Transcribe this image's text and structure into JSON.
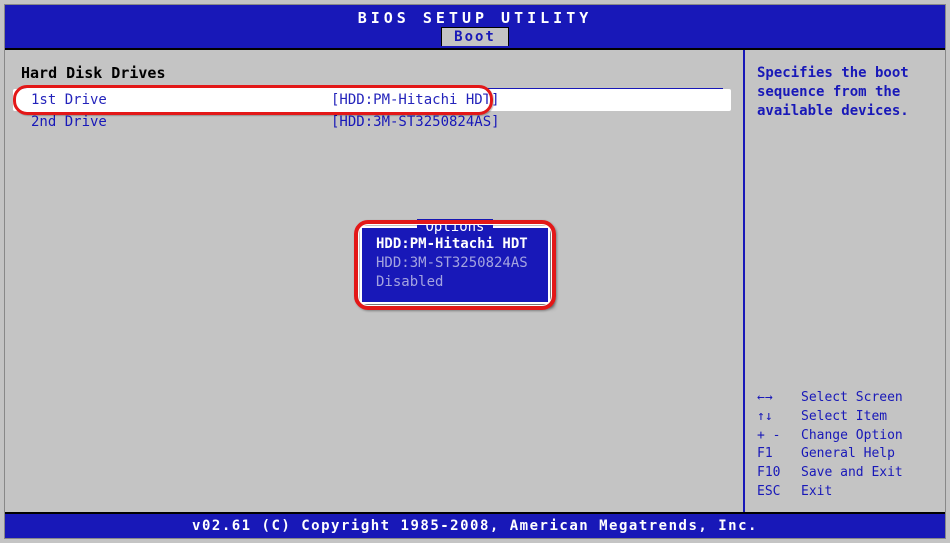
{
  "title": "BIOS SETUP UTILITY",
  "tab": "Boot",
  "section_title": "Hard Disk Drives",
  "drives": [
    {
      "label": "1st Drive",
      "value": "[HDD:PM-Hitachi HDT]"
    },
    {
      "label": "2nd Drive",
      "value": "[HDD:3M-ST3250824AS]"
    }
  ],
  "popup": {
    "title": "Options",
    "items": [
      "HDD:PM-Hitachi HDT",
      "HDD:3M-ST3250824AS",
      "Disabled"
    ],
    "selected_index": 0
  },
  "help_text": "Specifies the boot sequence from the available devices.",
  "keys": [
    {
      "k": "←→",
      "d": "Select Screen"
    },
    {
      "k": "↑↓",
      "d": "Select Item"
    },
    {
      "k": "+ -",
      "d": "Change Option"
    },
    {
      "k": "F1",
      "d": "General Help"
    },
    {
      "k": "F10",
      "d": "Save and Exit"
    },
    {
      "k": "ESC",
      "d": "Exit"
    }
  ],
  "footer": "v02.61 (C) Copyright 1985-2008, American Megatrends, Inc."
}
